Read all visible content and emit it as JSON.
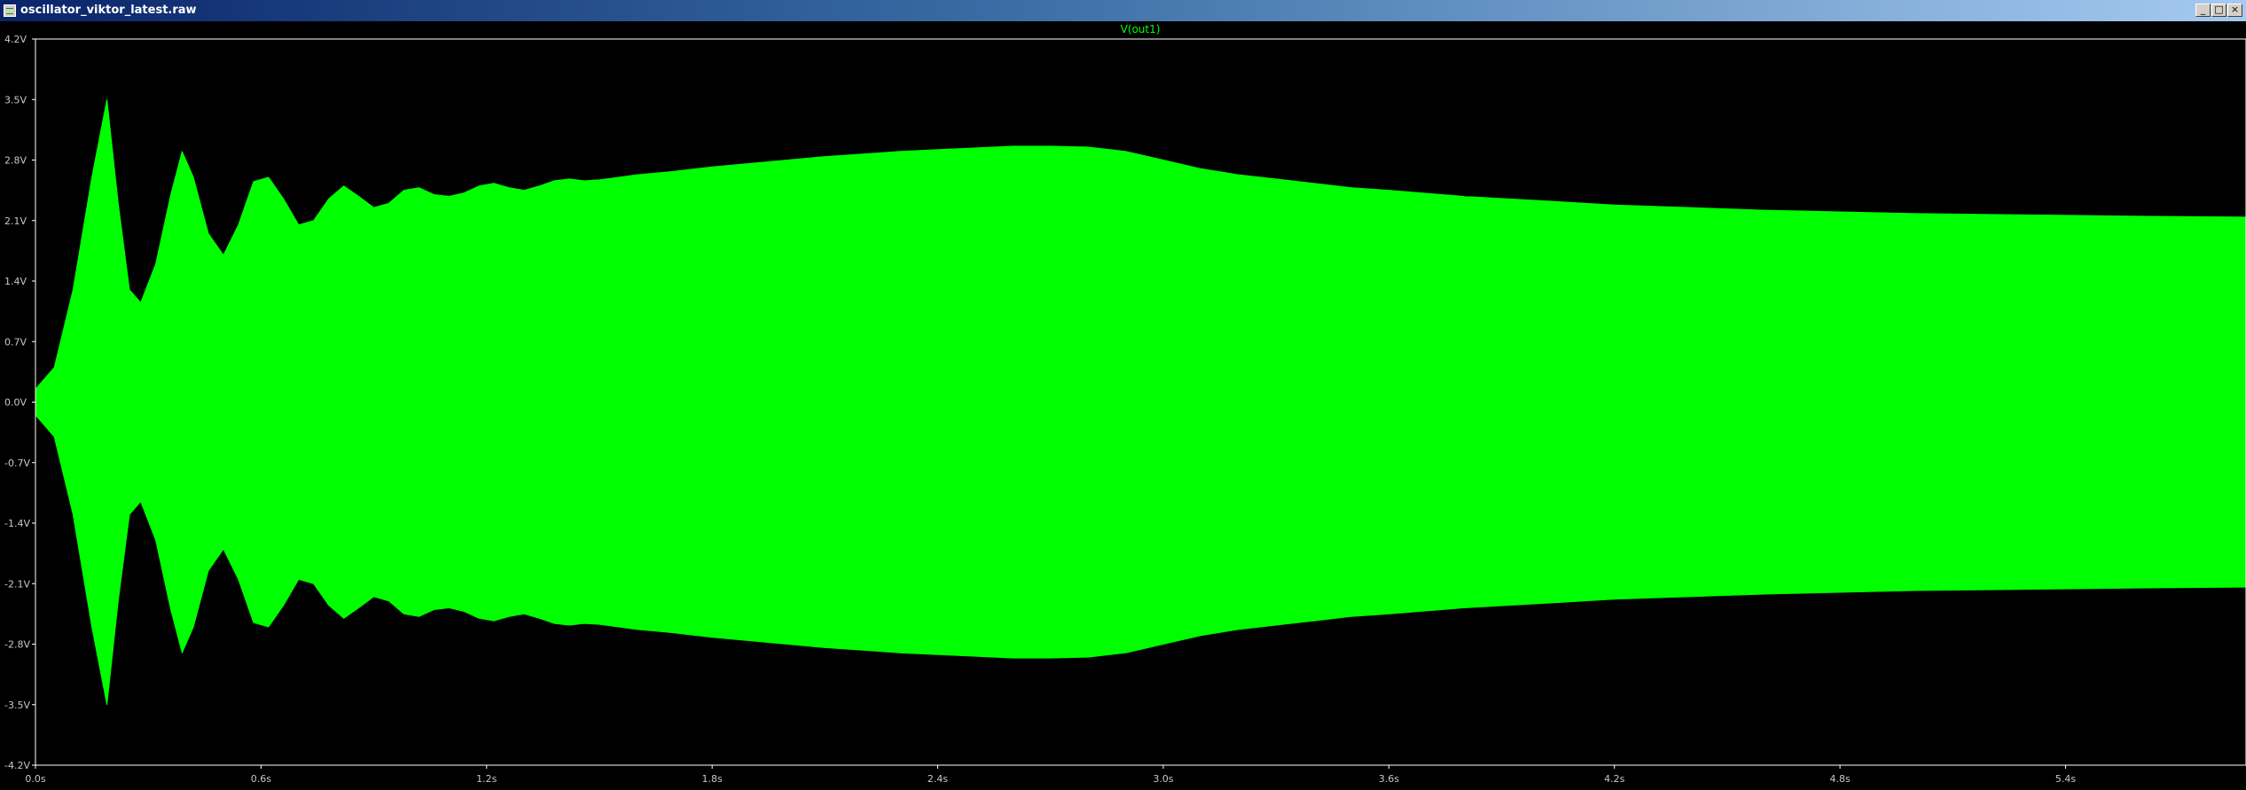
{
  "window": {
    "title": "oscillator_viktor_latest.raw",
    "icon": "waveform-app-icon",
    "buttons": {
      "minimize": "_",
      "maximize": "□",
      "close": "×"
    }
  },
  "colors": {
    "background": "#000000",
    "trace": "#00ff00",
    "axis": "#ffffff",
    "label": "#c8c8c8"
  },
  "chart_data": {
    "type": "area",
    "title": "V(out1)",
    "xlabel": "",
    "ylabel": "",
    "xlim": [
      0,
      5.88
    ],
    "ylim": [
      -4.2,
      4.2
    ],
    "x_ticks": [
      "0.0s",
      "0.6s",
      "1.2s",
      "1.8s",
      "2.4s",
      "3.0s",
      "3.6s",
      "4.2s",
      "4.8s",
      "5.4s"
    ],
    "x_tick_values": [
      0,
      0.6,
      1.2,
      1.8,
      2.4,
      3.0,
      3.6,
      4.2,
      4.8,
      5.4
    ],
    "y_ticks": [
      "4.2V",
      "3.5V",
      "2.8V",
      "2.1V",
      "1.4V",
      "0.7V",
      "0.0V",
      "-0.7V",
      "-1.4V",
      "-2.1V",
      "-2.8V",
      "-3.5V",
      "-4.2V"
    ],
    "y_tick_values": [
      4.2,
      3.5,
      2.8,
      2.1,
      1.4,
      0.7,
      0,
      -0.7,
      -1.4,
      -2.1,
      -2.8,
      -3.5,
      -4.2
    ],
    "series": [
      {
        "name": "V(out1)",
        "color": "#00ff00",
        "x": [
          0,
          0.05,
          0.1,
          0.15,
          0.19,
          0.22,
          0.25,
          0.28,
          0.32,
          0.36,
          0.39,
          0.42,
          0.46,
          0.5,
          0.54,
          0.58,
          0.62,
          0.66,
          0.7,
          0.74,
          0.78,
          0.82,
          0.86,
          0.9,
          0.94,
          0.98,
          1.02,
          1.06,
          1.1,
          1.14,
          1.18,
          1.22,
          1.26,
          1.3,
          1.34,
          1.38,
          1.42,
          1.46,
          1.5,
          1.6,
          1.7,
          1.8,
          1.9,
          2.0,
          2.1,
          2.2,
          2.3,
          2.4,
          2.5,
          2.6,
          2.7,
          2.8,
          2.9,
          3.0,
          3.1,
          3.2,
          3.3,
          3.4,
          3.5,
          3.6,
          3.8,
          4.0,
          4.2,
          4.4,
          4.6,
          4.8,
          5.0,
          5.2,
          5.4,
          5.6,
          5.88
        ],
        "upper": [
          0.15,
          0.4,
          1.3,
          2.6,
          3.5,
          2.3,
          1.3,
          1.15,
          1.6,
          2.4,
          2.9,
          2.6,
          1.95,
          1.7,
          2.05,
          2.55,
          2.6,
          2.35,
          2.05,
          2.1,
          2.35,
          2.5,
          2.38,
          2.25,
          2.3,
          2.45,
          2.48,
          2.4,
          2.38,
          2.42,
          2.5,
          2.53,
          2.48,
          2.45,
          2.5,
          2.56,
          2.58,
          2.56,
          2.57,
          2.63,
          2.67,
          2.72,
          2.76,
          2.8,
          2.84,
          2.87,
          2.9,
          2.92,
          2.94,
          2.96,
          2.96,
          2.95,
          2.9,
          2.8,
          2.7,
          2.63,
          2.58,
          2.53,
          2.48,
          2.45,
          2.38,
          2.33,
          2.28,
          2.25,
          2.22,
          2.2,
          2.18,
          2.17,
          2.16,
          2.15,
          2.14
        ],
        "lower": [
          -0.15,
          -0.4,
          -1.3,
          -2.6,
          -3.5,
          -2.3,
          -1.3,
          -1.15,
          -1.6,
          -2.4,
          -2.9,
          -2.6,
          -1.95,
          -1.7,
          -2.05,
          -2.55,
          -2.6,
          -2.35,
          -2.05,
          -2.1,
          -2.35,
          -2.5,
          -2.38,
          -2.25,
          -2.3,
          -2.45,
          -2.48,
          -2.4,
          -2.38,
          -2.42,
          -2.5,
          -2.53,
          -2.48,
          -2.45,
          -2.5,
          -2.56,
          -2.58,
          -2.56,
          -2.57,
          -2.63,
          -2.67,
          -2.72,
          -2.76,
          -2.8,
          -2.84,
          -2.87,
          -2.9,
          -2.92,
          -2.94,
          -2.96,
          -2.96,
          -2.95,
          -2.9,
          -2.8,
          -2.7,
          -2.63,
          -2.58,
          -2.53,
          -2.48,
          -2.45,
          -2.38,
          -2.33,
          -2.28,
          -2.25,
          -2.22,
          -2.2,
          -2.18,
          -2.17,
          -2.16,
          -2.15,
          -2.14
        ]
      }
    ],
    "grid": false,
    "legend": "none"
  }
}
